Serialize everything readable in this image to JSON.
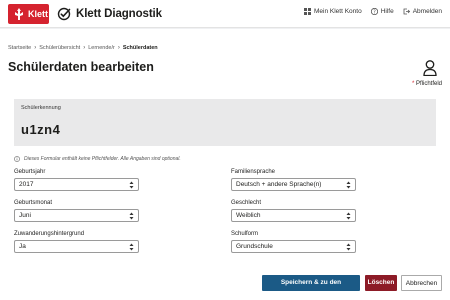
{
  "header": {
    "logo_text": "Klett",
    "brand_title": "Klett Diagnostik",
    "nav": [
      {
        "label": "Mein Klett Konto",
        "icon": "grid-icon"
      },
      {
        "label": "Hilfe",
        "icon": "help-icon"
      },
      {
        "label": "Abmelden",
        "icon": "logout-icon"
      }
    ]
  },
  "breadcrumb": [
    "Startseite",
    "Schülerübersicht",
    "Lernende/r",
    "Schülerdaten"
  ],
  "page": {
    "title": "Schülerdaten bearbeiten",
    "required_note": "Pflichtfeld",
    "required_star": "*"
  },
  "student": {
    "id_label": "Schülerkennung",
    "id_value": "u1zn4"
  },
  "info_text": "Dieses Formular enthält keine Pflichtfelder. Alle Angaben sind optional.",
  "form": {
    "birth_year": {
      "label": "Geburtsjahr",
      "value": "2017"
    },
    "birth_month": {
      "label": "Geburtsmonat",
      "value": "Juni"
    },
    "migration": {
      "label": "Zuwanderungshintergrund",
      "value": "Ja"
    },
    "family_language": {
      "label": "Familiensprache",
      "value": "Deutsch + andere Sprache(n)"
    },
    "gender": {
      "label": "Geschlecht",
      "value": "Weiblich"
    },
    "school_type": {
      "label": "Schulform",
      "value": "Grundschule"
    }
  },
  "buttons": {
    "save": "Speichern & zu den Schülerdetails",
    "delete": "Löschen",
    "cancel": "Abbrechen"
  },
  "colors": {
    "brand_red": "#d5232f",
    "primary_blue": "#1b5a86",
    "delete_red": "#8d1b27"
  }
}
